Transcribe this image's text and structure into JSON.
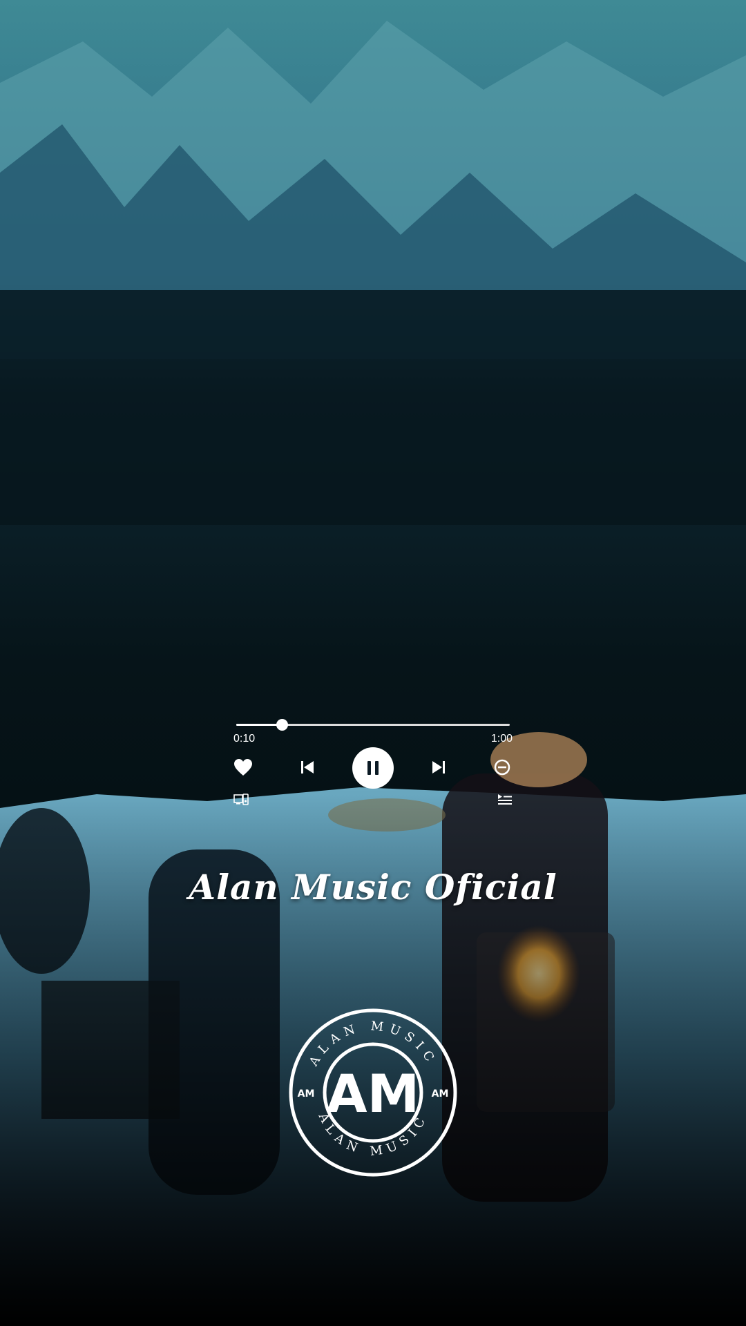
{
  "player": {
    "elapsed": "0:10",
    "total": "1:00",
    "progress_fraction": 0.167,
    "state": "playing"
  },
  "icons": {
    "like": "heart-icon",
    "previous": "skip-previous-icon",
    "play_pause": "pause-icon",
    "next": "skip-next-icon",
    "remove": "minus-circle-icon",
    "devices": "connect-devices-icon",
    "queue": "queue-icon"
  },
  "channel": {
    "title": "Alan Music Oficial"
  },
  "logo": {
    "ring_text_top": "ALAN MUSIC",
    "ring_text_bottom": "ALAN MUSIC",
    "monogram": "AM",
    "side_marks": [
      "AM",
      "AM"
    ]
  },
  "colors": {
    "control": "#ffffff",
    "pause_glyph": "#0b1a24"
  }
}
